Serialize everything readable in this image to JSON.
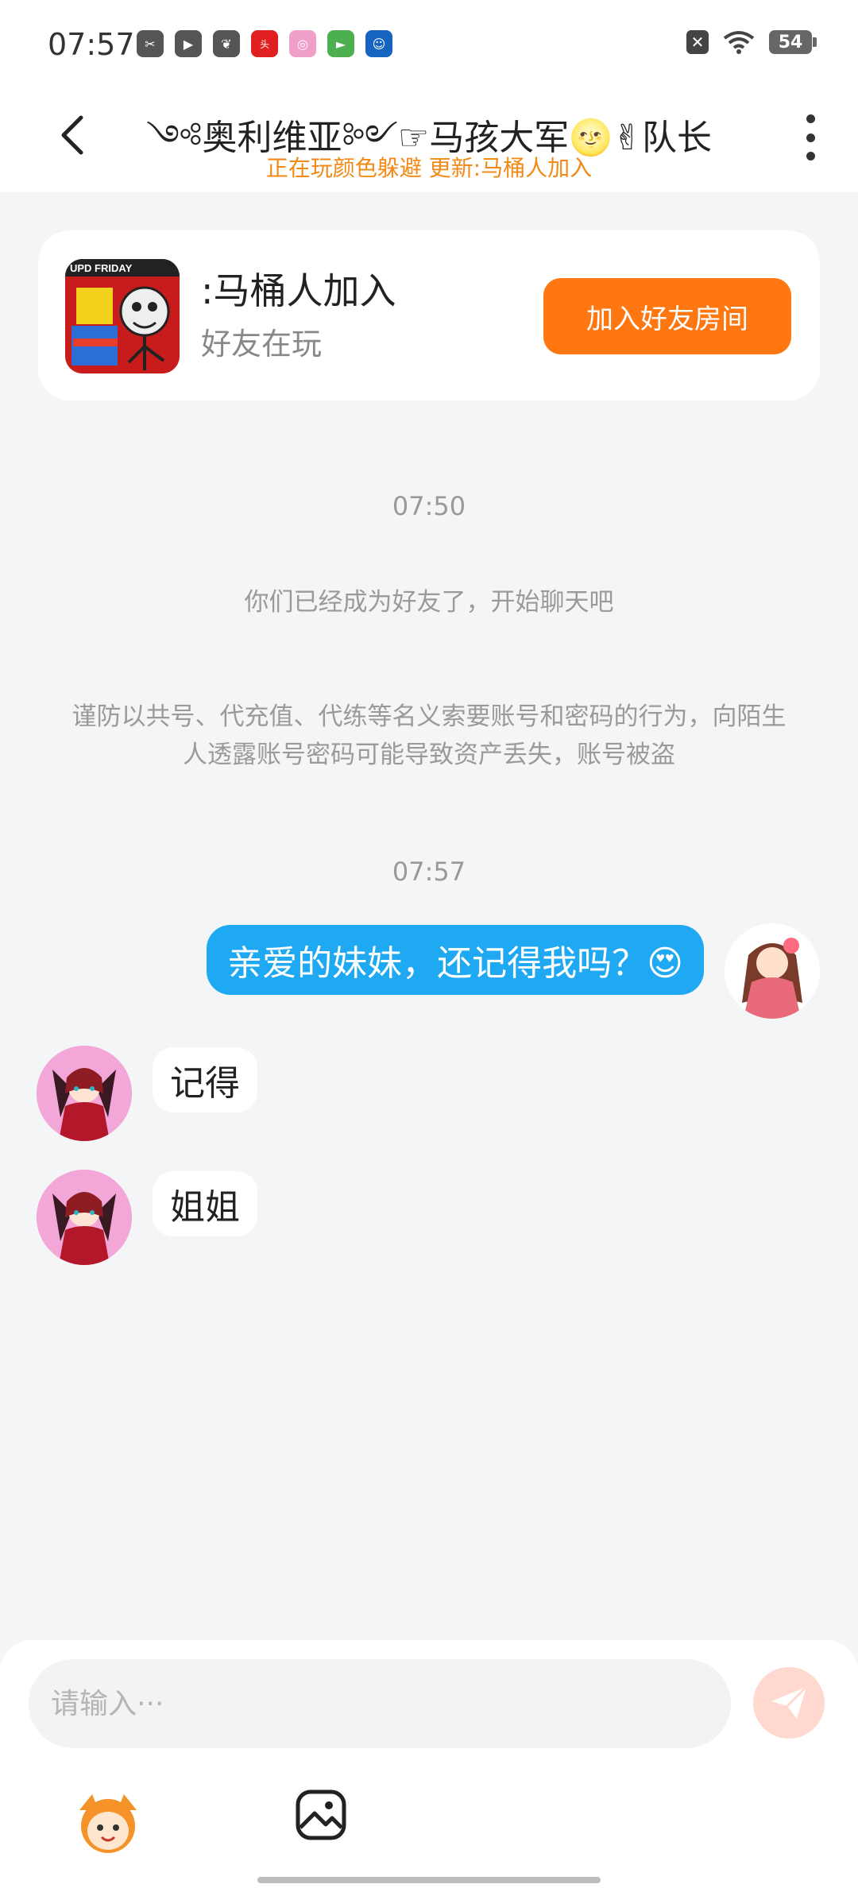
{
  "status_bar": {
    "time": "07:57",
    "battery": "54",
    "app_icons": [
      "scissors-app-icon",
      "play-app-icon",
      "leaf-app-icon",
      "toutiao-app-icon",
      "camera-app-icon",
      "video-app-icon",
      "game-app-icon"
    ]
  },
  "header": {
    "title": "༺奥利维亚༻☞马孩大军🌝✌队长",
    "subtitle": "正在玩颜色躲避 更新:马桶人加入"
  },
  "game_card": {
    "name": ":马桶人加入",
    "status": "好友在玩",
    "join_button": "加入好友房间"
  },
  "chat": {
    "time_1": "07:50",
    "friend_notice": "你们已经成为好友了，开始聊天吧",
    "security_notice": "谨防以共号、代充值、代练等名义索要账号和密码的行为，向陌生人透露账号密码可能导致资产丢失，账号被盗",
    "time_2": "07:57",
    "messages": [
      {
        "from": "me",
        "text": "亲爱的妹妹，还记得我吗？😍"
      },
      {
        "from": "other",
        "text": "记得"
      },
      {
        "from": "other",
        "text": "姐姐"
      }
    ]
  },
  "composer": {
    "placeholder": "请输入···"
  },
  "colors": {
    "accent_orange": "#ff7711",
    "bubble_blue": "#1ea9f2",
    "subtitle_orange": "#f28a17"
  }
}
